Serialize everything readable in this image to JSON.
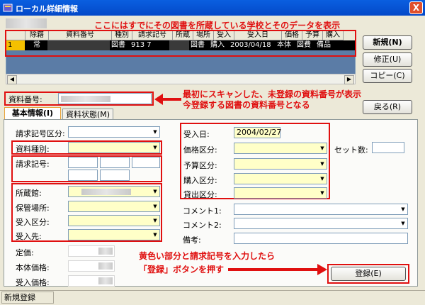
{
  "window": {
    "title": "ローカル詳細情報",
    "close_label": "X"
  },
  "annotations": {
    "top": "ここにはすでにその図書を所蔵している学校とそのデータを表示",
    "scan_line1": "最初にスキャンした、未登録の資料番号が表示",
    "scan_line2": "今登録する図書の資料番号となる",
    "bottom_line1": "黄色い部分と請求記号を入力したら",
    "bottom_line2": "「登録」ボタンを押す"
  },
  "grid": {
    "headers": [
      "",
      "除籍",
      "資料番号",
      "種別",
      "請求記号",
      "所蔵",
      "場所",
      "受入",
      "受入日",
      "価格",
      "予算",
      "購入"
    ],
    "rows": [
      {
        "num": "1",
        "jyoseki": "常",
        "shubetsu": "図書",
        "seikyu": "913 7",
        "basho": "図書",
        "ukeire": "購入",
        "date": "2003/04/18",
        "kakaku": "本体",
        "yosan": "図費",
        "konyu": "備品"
      }
    ]
  },
  "buttons": {
    "new": "新規(N)",
    "edit": "修正(U)",
    "copy": "コピー(C)",
    "back": "戻る(R)",
    "register": "登録(E)"
  },
  "fields": {
    "shiryo_label": "資料番号:",
    "tab_basic": "基本情報(I)",
    "tab_status": "資料状態(M)",
    "seikyu_kubun": "請求記号区分:",
    "shiryo_shubetsu": "資料種別:",
    "seikyu_kigo": "請求記号:",
    "shozokan": "所蔵館:",
    "hokan_basho": "保管場所:",
    "ukeire_kubun": "受入区分:",
    "ukeire_saki": "受入先:",
    "teika": "定価:",
    "hontai_kakaku": "本体価格:",
    "ukeire_kakaku": "受入価格:",
    "ukeire_bi": "受入日:",
    "ukeire_bi_value": "2004/02/27",
    "kakaku_kubun": "価格区分:",
    "set_su": "セット数:",
    "yosan_kubun": "予算区分:",
    "konyu_kubun": "購入区分:",
    "kashidashi_kubun": "貸出区分:",
    "comment1": "コメント1:",
    "comment2": "コメント2:",
    "biko": "備考:"
  },
  "status": {
    "mode": "新規登録"
  },
  "colors": {
    "annotation": "#e01010",
    "required_field": "#ffffc8",
    "grid_bg": "#5b7ca6",
    "title_bar": "#0a5fe0"
  }
}
